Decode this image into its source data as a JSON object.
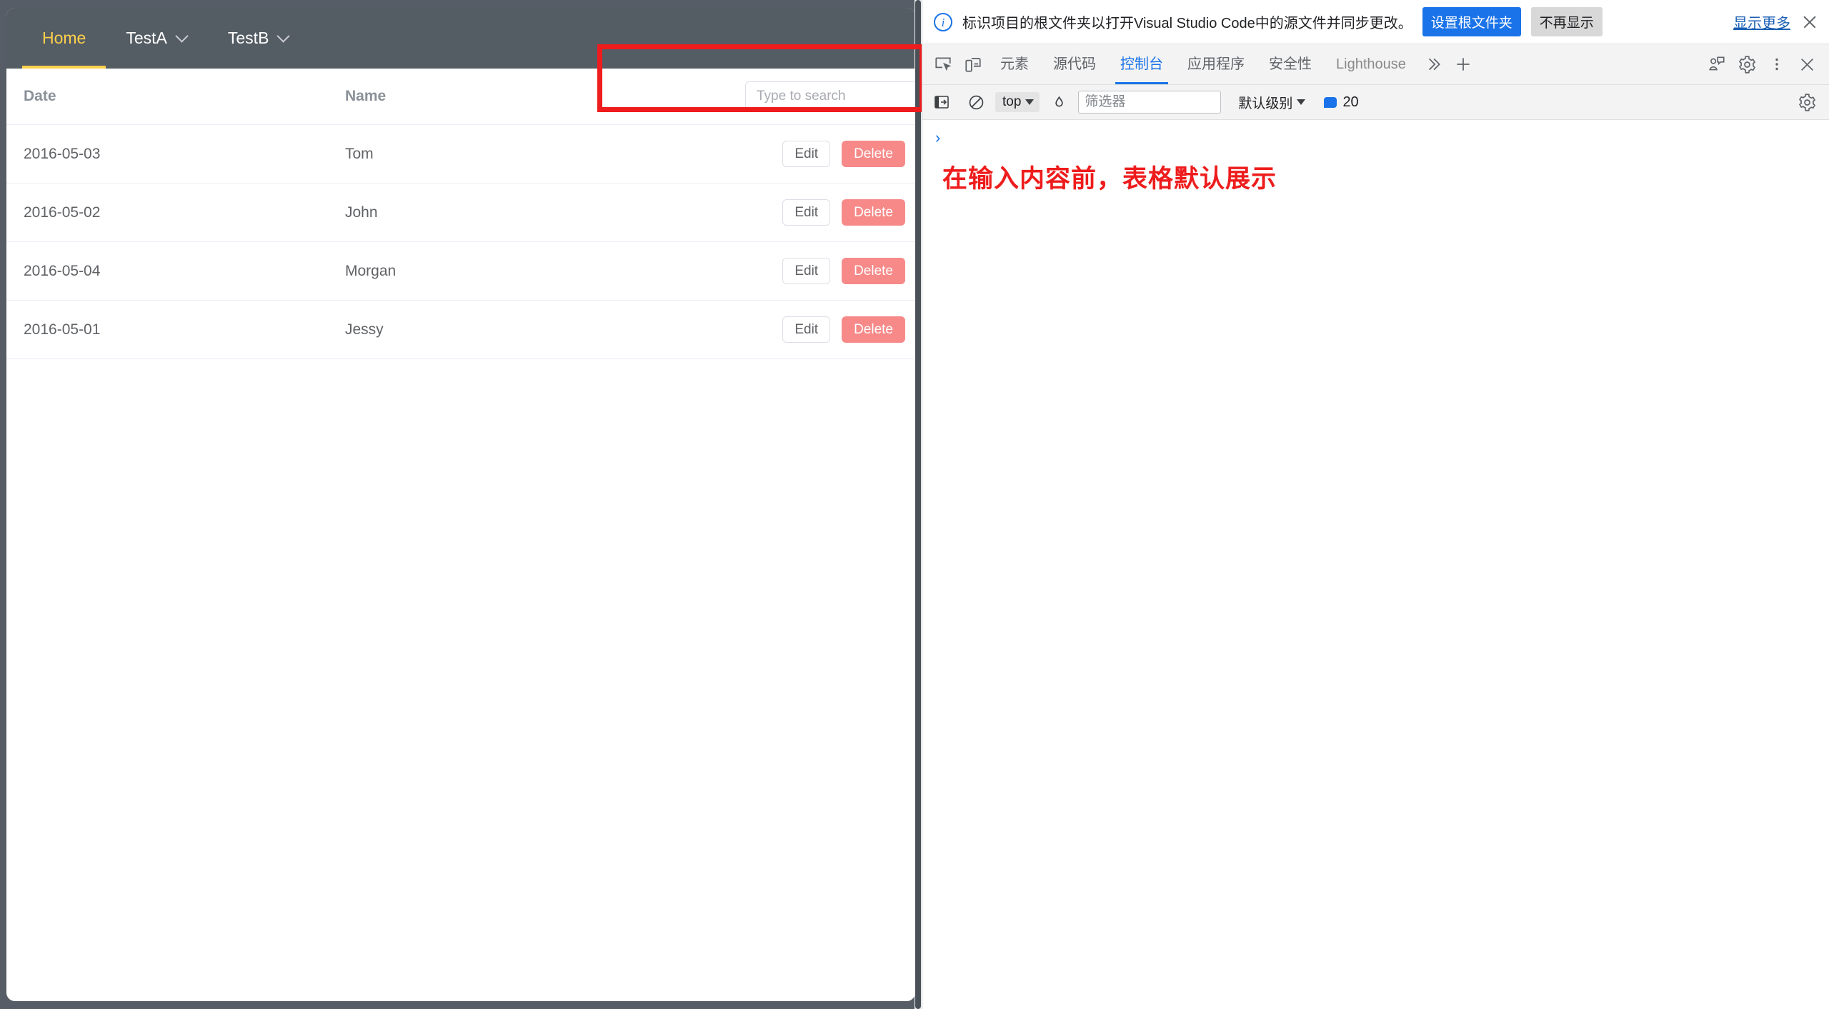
{
  "page": {
    "nav": {
      "items": [
        {
          "label": "Home",
          "active": true,
          "has_dropdown": false
        },
        {
          "label": "TestA",
          "active": false,
          "has_dropdown": true
        },
        {
          "label": "TestB",
          "active": false,
          "has_dropdown": true
        }
      ]
    },
    "table": {
      "headers": {
        "date": "Date",
        "name": "Name"
      },
      "search": {
        "placeholder": "Type to search",
        "value": ""
      },
      "rows": [
        {
          "date": "2016-05-03",
          "name": "Tom",
          "edit": "Edit",
          "delete": "Delete"
        },
        {
          "date": "2016-05-02",
          "name": "John",
          "edit": "Edit",
          "delete": "Delete"
        },
        {
          "date": "2016-05-04",
          "name": "Morgan",
          "edit": "Edit",
          "delete": "Delete"
        },
        {
          "date": "2016-05-01",
          "name": "Jessy",
          "edit": "Edit",
          "delete": "Delete"
        }
      ]
    },
    "colors": {
      "nav_bg": "#545c64",
      "nav_active": "#ffd04b",
      "delete_btn": "#f78989",
      "annotation": "#ee1c1c"
    }
  },
  "devtools": {
    "banner": {
      "icon": "info-icon",
      "message": "标识项目的根文件夹以打开Visual Studio Code中的源文件并同步更改。",
      "primary_button": "设置根文件夹",
      "secondary_button": "不再显示",
      "show_more_link": "显示更多"
    },
    "tabs": [
      {
        "label": "元素",
        "active": false,
        "muted": false
      },
      {
        "label": "源代码",
        "active": false,
        "muted": false
      },
      {
        "label": "控制台",
        "active": true,
        "muted": false
      },
      {
        "label": "应用程序",
        "active": false,
        "muted": false
      },
      {
        "label": "安全性",
        "active": false,
        "muted": false
      },
      {
        "label": "Lighthouse",
        "active": false,
        "muted": true
      }
    ],
    "console_toolbar": {
      "context": "top",
      "filter_placeholder": "筛选器",
      "filter_value": "",
      "level": "默认级别",
      "message_count": "20"
    },
    "console_body": {
      "prompt": "›",
      "annotation": "在输入内容前，表格默认展示"
    }
  }
}
